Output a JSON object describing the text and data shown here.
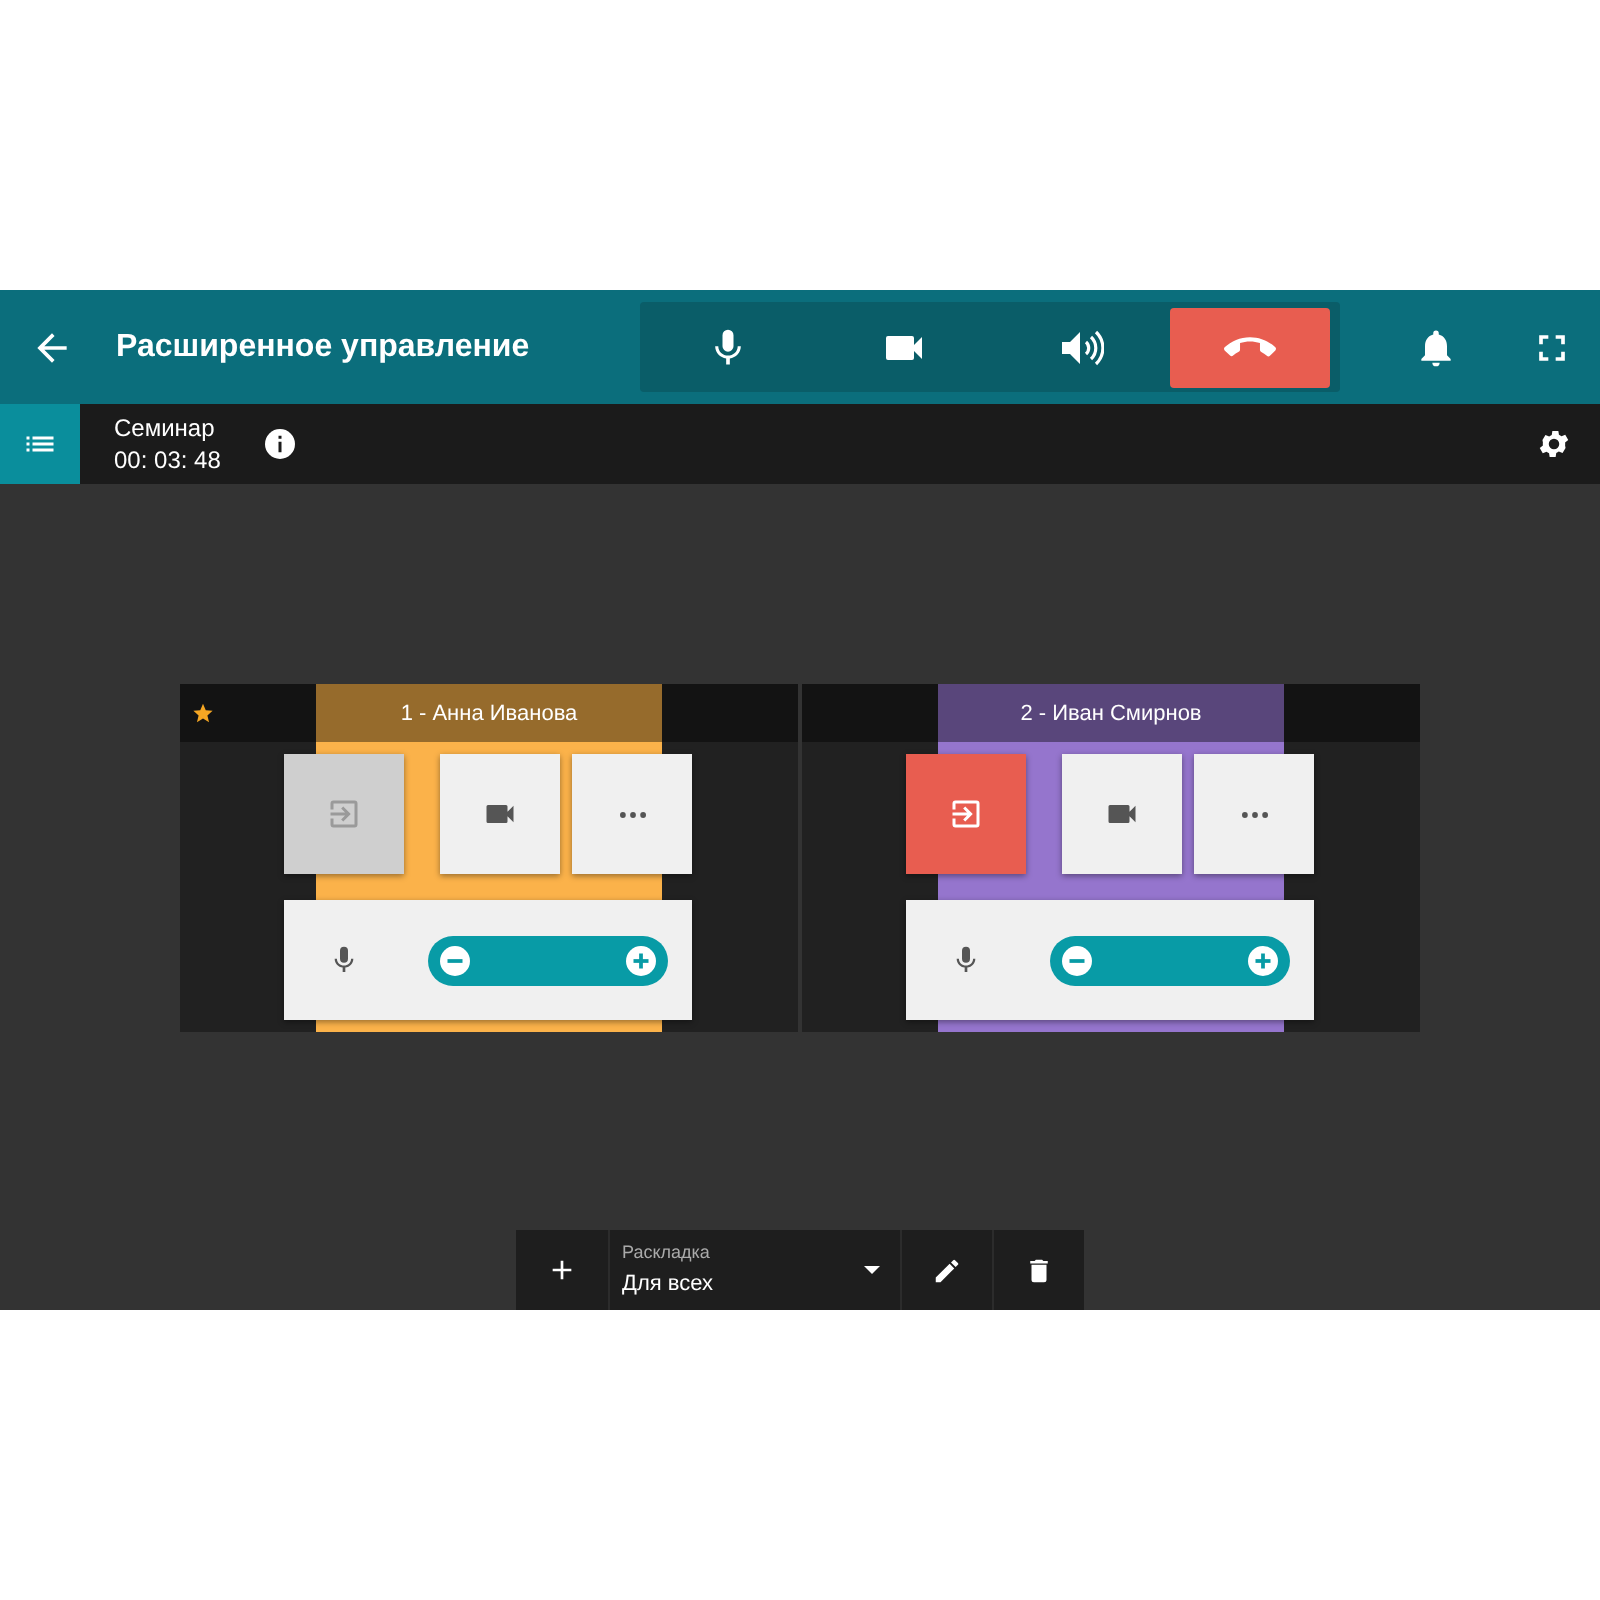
{
  "header": {
    "title": "Расширенное управление"
  },
  "session": {
    "name": "Семинар",
    "timer": "00: 03: 48"
  },
  "participants": [
    {
      "label": "1 - Анна Иванова",
      "color": "#fbb24a",
      "starred": true,
      "entrance_active": false
    },
    {
      "label": "2 - Иван Смирнов",
      "color": "#9575cd",
      "starred": false,
      "entrance_active": true
    }
  ],
  "layout_picker": {
    "caption": "Раскладка",
    "value": "Для всех"
  }
}
